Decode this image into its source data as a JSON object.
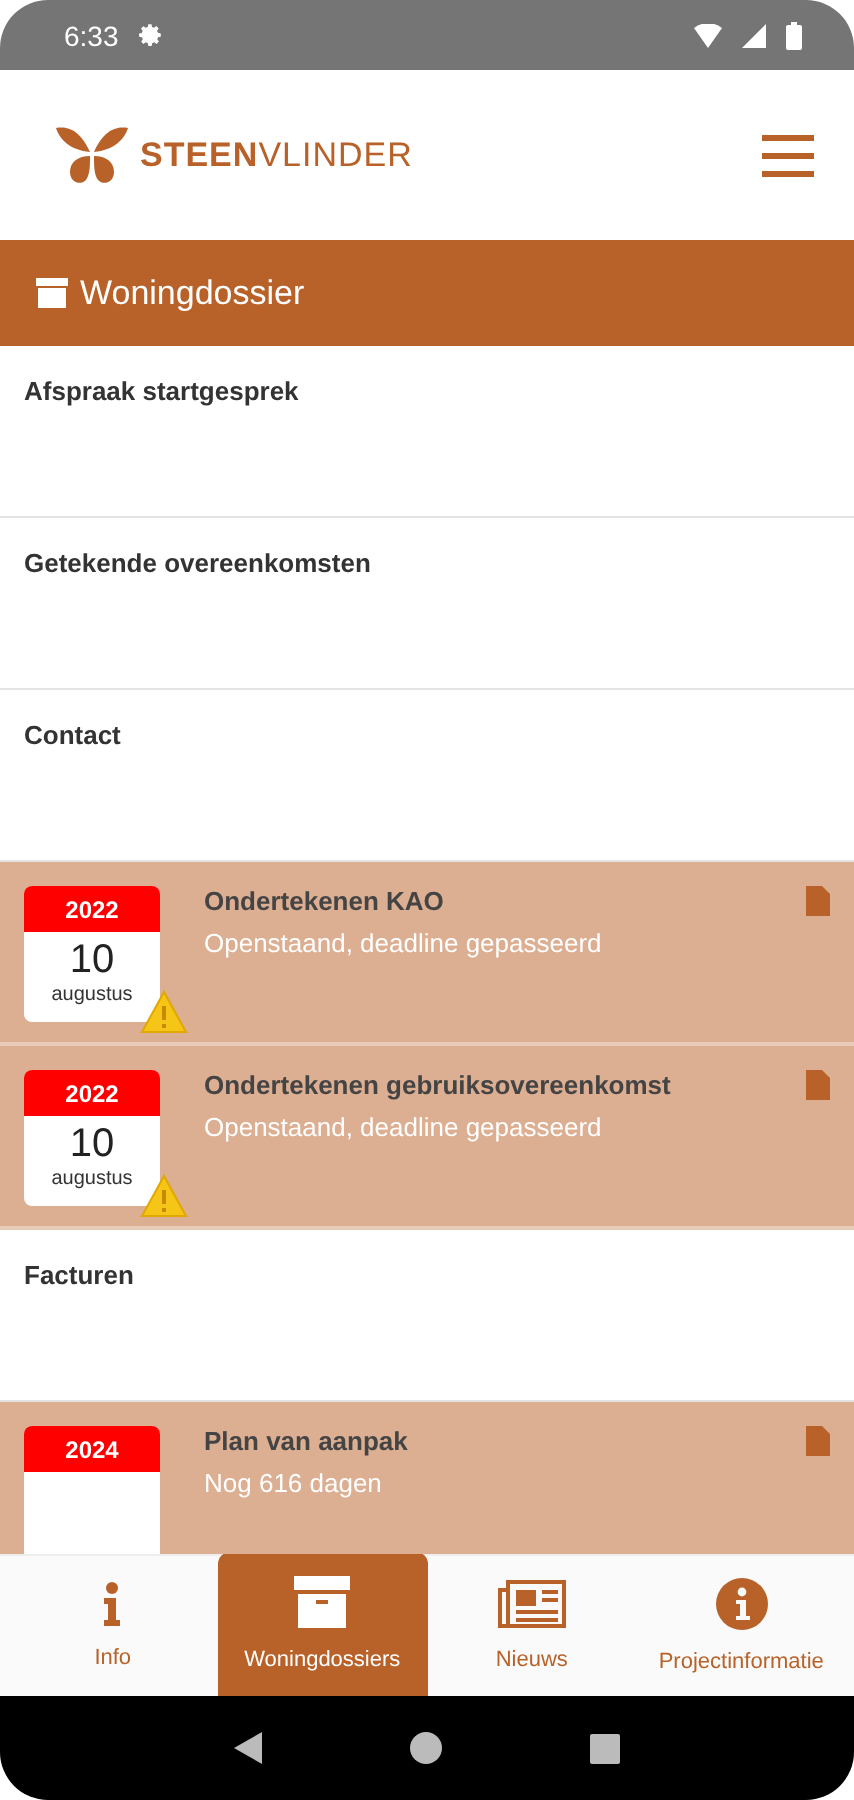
{
  "status_bar": {
    "time": "6:33"
  },
  "header": {
    "brand_bold": "STEEN",
    "brand_light": "VLINDER"
  },
  "title_bar": {
    "title": "Woningdossier"
  },
  "sections": [
    {
      "kind": "heading",
      "title": "Afspraak startgesprek"
    },
    {
      "kind": "heading",
      "title": "Getekende overeenkomsten"
    },
    {
      "kind": "heading",
      "title": "Contact"
    },
    {
      "kind": "task",
      "year": "2022",
      "day": "10",
      "month": "augustus",
      "overdue": true,
      "title": "Ondertekenen KAO",
      "status": "Openstaand, deadline gepasseerd"
    },
    {
      "kind": "task",
      "year": "2022",
      "day": "10",
      "month": "augustus",
      "overdue": true,
      "title": "Ondertekenen gebruiksovereenkomst",
      "status": "Openstaand, deadline gepasseerd"
    },
    {
      "kind": "heading",
      "title": "Facturen"
    },
    {
      "kind": "task",
      "year": "2024",
      "overdue": false,
      "title": "Plan van aanpak",
      "status": "Nog 616 dagen"
    }
  ],
  "tabs": [
    {
      "kind": "info",
      "label": "Info",
      "selected": false
    },
    {
      "kind": "box",
      "label": "Woningdossiers",
      "selected": true
    },
    {
      "kind": "news",
      "label": "Nieuws",
      "selected": false
    },
    {
      "kind": "circle-info",
      "label": "Projectinformatie",
      "selected": false
    }
  ]
}
